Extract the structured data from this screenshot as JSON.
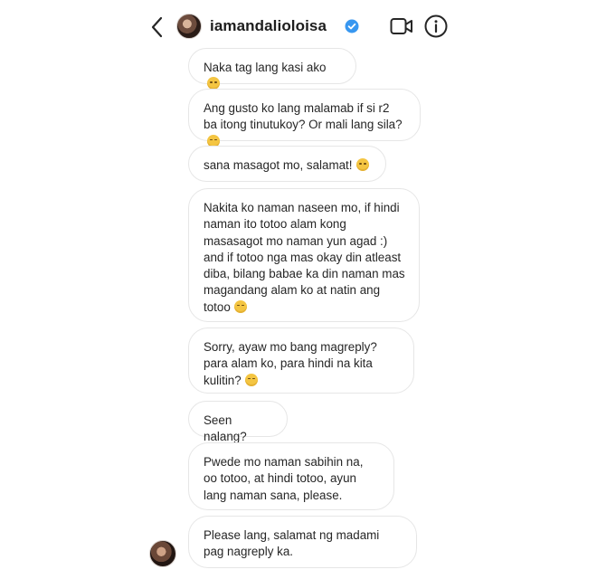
{
  "header": {
    "username": "iamandalioloisa",
    "icons": {
      "back": "chevron-left-icon",
      "verified": "verified-badge-icon",
      "video": "video-call-icon",
      "info": "info-icon"
    }
  },
  "colors": {
    "verified_badge": "#3897f0",
    "bubble_border": "#e6e6e6",
    "text": "#262626"
  },
  "messages": [
    {
      "text": "Naka tag lang kasi ako",
      "emoji": true
    },
    {
      "text": "Ang gusto ko lang malamab if si r2 ba itong tinutukoy? Or mali lang sila?",
      "emoji": true
    },
    {
      "text": "sana masagot mo, salamat!",
      "emoji": true
    },
    {
      "text": "Nakita ko naman naseen mo, if hindi naman ito totoo alam kong masasagot mo naman yun agad :) and if totoo nga mas okay din atleast diba, bilang babae ka din naman mas magandang alam ko at natin ang totoo",
      "emoji": true
    },
    {
      "text": "Sorry, ayaw mo bang magreply? para alam ko, para hindi na kita kulitin?",
      "emoji": true
    },
    {
      "text": "Seen nalang?",
      "emoji": false
    },
    {
      "text": "Pwede mo naman sabihin na, oo totoo, at hindi totoo, ayun lang naman sana, please.",
      "emoji": false
    },
    {
      "text": "Please lang, salamat ng madami pag nagreply ka.",
      "emoji": false
    }
  ]
}
